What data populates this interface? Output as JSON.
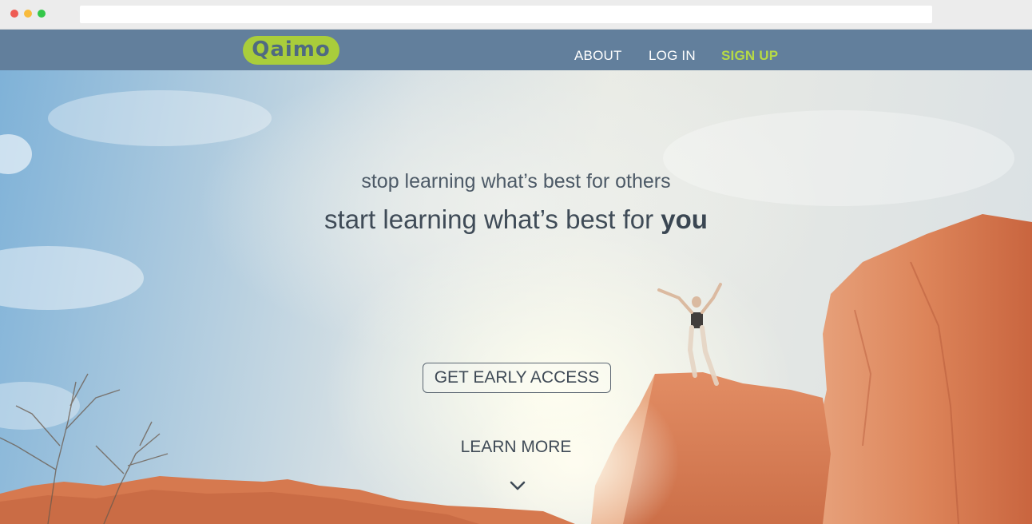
{
  "browser": {
    "url": ""
  },
  "nav": {
    "logo_text": "Qaimo",
    "about": "ABOUT",
    "login": "LOG IN",
    "signup": "SIGN UP"
  },
  "hero": {
    "tagline_line1": "stop learning what’s best for others",
    "tagline_line2_prefix": "start learning what’s best for ",
    "tagline_line2_emphasis": "you",
    "cta_label": "GET EARLY ACCESS",
    "learn_more_label": "LEARN MORE",
    "scroll_icon": "chevron-down-icon"
  },
  "colors": {
    "navbar": "#627f9c",
    "logo_bg": "#a9cd3b",
    "signup": "#b6da45",
    "text_dark": "#3f4b57"
  }
}
